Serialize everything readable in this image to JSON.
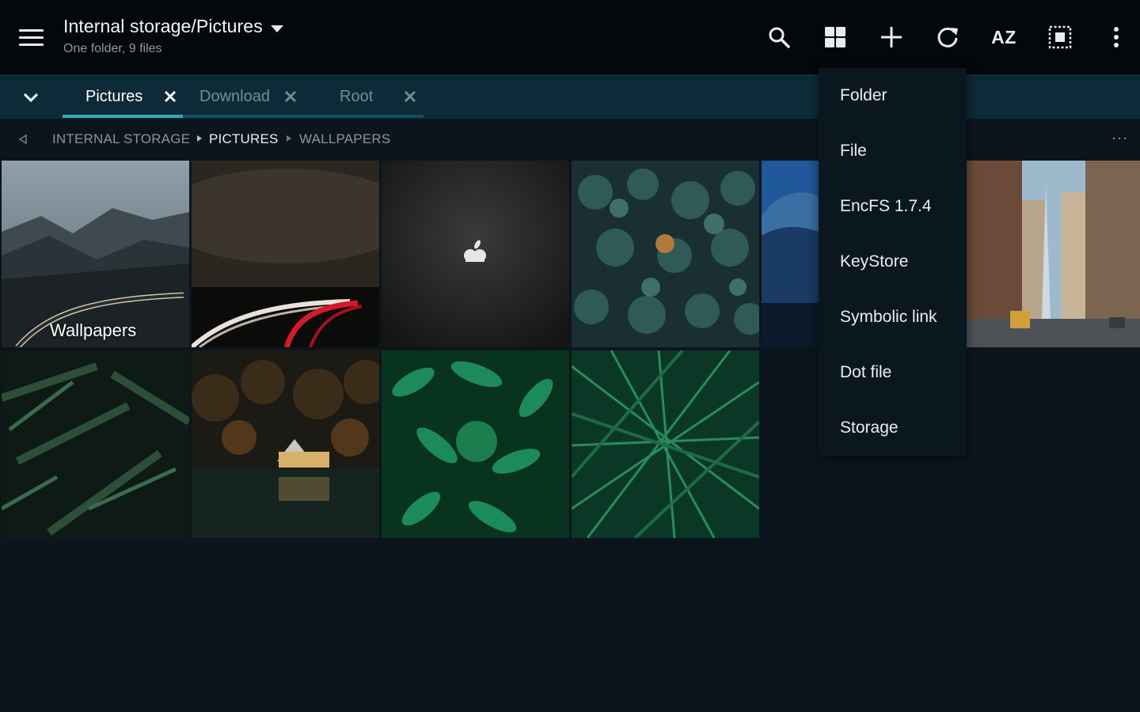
{
  "header": {
    "title": "Internal storage/Pictures",
    "subtitle": "One folder, 9 files",
    "actions": {
      "search": "search-icon",
      "grid_view": "grid-view-icon",
      "add": "add-icon",
      "refresh": "refresh-icon",
      "sort_label": "AZ",
      "select_all": "select-all-icon",
      "overflow": "more-vert-icon"
    }
  },
  "tabs": [
    {
      "label": "Pictures",
      "active": true
    },
    {
      "label": "Download",
      "active": false
    },
    {
      "label": "Root",
      "active": false
    }
  ],
  "breadcrumb": {
    "items": [
      "INTERNAL STORAGE",
      "PICTURES",
      "WALLPAPERS"
    ],
    "more": "···"
  },
  "grid": {
    "folder_label": "Wallpapers",
    "items": [
      {
        "type": "folder",
        "subject": "mountain road"
      },
      {
        "type": "image",
        "subject": "light trails at night"
      },
      {
        "type": "image",
        "subject": "dark apple logo"
      },
      {
        "type": "image",
        "subject": "pine forest aerial"
      },
      {
        "type": "image",
        "subject": "blue mountain"
      },
      {
        "type": "image",
        "subject": "city street"
      },
      {
        "type": "image",
        "subject": "dark ferns"
      },
      {
        "type": "image",
        "subject": "lake house at night"
      },
      {
        "type": "image",
        "subject": "green leaves"
      },
      {
        "type": "image",
        "subject": "green grass"
      }
    ]
  },
  "create_menu": {
    "items": [
      "Folder",
      "File",
      "EncFS 1.7.4",
      "KeyStore",
      "Symbolic link",
      "Dot file",
      "Storage"
    ]
  },
  "colors": {
    "toolbar_bg": "#04080b",
    "tabbar_bg": "#0d2a38",
    "accent": "#3aa6b9",
    "page_bg": "#0c151d"
  }
}
